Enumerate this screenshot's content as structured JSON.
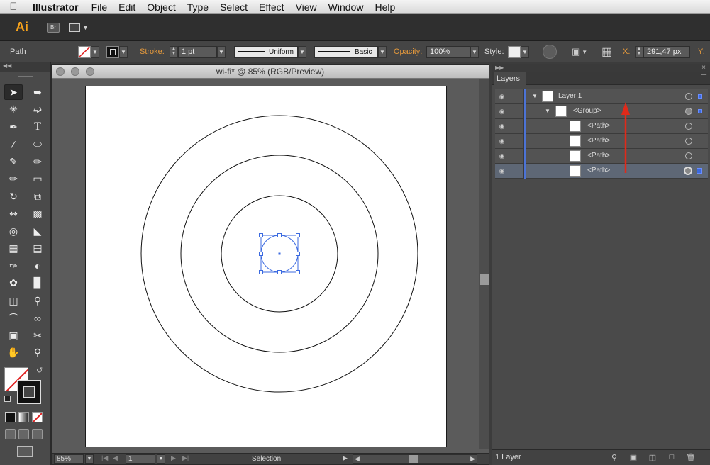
{
  "menubar": {
    "app_name": "Illustrator",
    "items": [
      "File",
      "Edit",
      "Object",
      "Type",
      "Select",
      "Effect",
      "View",
      "Window",
      "Help"
    ]
  },
  "appbar": {
    "logo": "Ai",
    "bridge_label": "Br"
  },
  "controlbar": {
    "selection_type": "Path",
    "stroke_label": "Stroke:",
    "stroke_weight": "1 pt",
    "variable_width_profile": "Uniform",
    "brush_definition": "Basic",
    "opacity_label": "Opacity:",
    "opacity_value": "100%",
    "style_label": "Style:",
    "x_label": "X:",
    "x_value": "291,47 px",
    "y_label": "Y:"
  },
  "document": {
    "title": "wi-fi* @ 85% (RGB/Preview)",
    "zoom": "85%",
    "artboard_number": "1",
    "status": "Selection"
  },
  "layers_panel": {
    "tab_label": "Layers",
    "rows": [
      {
        "name": "Layer 1",
        "indent": 0,
        "expanded": true,
        "selected": false
      },
      {
        "name": "<Group>",
        "indent": 1,
        "expanded": true,
        "selected": false
      },
      {
        "name": "<Path>",
        "indent": 2,
        "selected": false
      },
      {
        "name": "<Path>",
        "indent": 2,
        "selected": false
      },
      {
        "name": "<Path>",
        "indent": 2,
        "selected": false
      },
      {
        "name": "<Path>",
        "indent": 2,
        "selected": true
      }
    ],
    "footer_count": "1 Layer"
  },
  "colors": {
    "accent_orange": "#e69a3c",
    "layer_color": "#4c73d6",
    "selection_color": "#3b6ae0",
    "annotation_arrow": "#e02a1a"
  }
}
